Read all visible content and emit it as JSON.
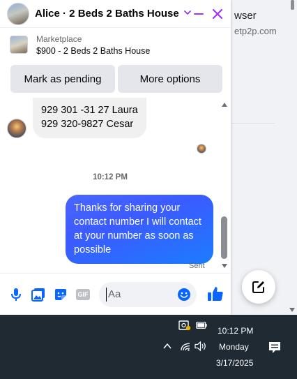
{
  "background": {
    "title": "wser",
    "subtitle": "etp2p.com"
  },
  "chat": {
    "header": {
      "title": "Alice · 2 Beds 2 Baths House",
      "accent_color": "#a033ff"
    },
    "marketplace": {
      "label": "Marketplace",
      "item": "$900 - 2 Beds 2 Baths House"
    },
    "actions": {
      "mark_pending": "Mark as pending",
      "more_options": "More options"
    },
    "messages": {
      "incoming_line1": "929 301 -31 27 Laura",
      "incoming_line2": "929 320-9827 Cesar",
      "time": "10:12 PM",
      "outgoing": "Thanks for sharing your contact number I will contact at your number as soon as possible",
      "status": "Sent",
      "outgoing_color": "#3b5bff"
    },
    "composer": {
      "placeholder": "Aa",
      "gif_label": "GIF",
      "icon_color": "#0866ff",
      "icons": [
        "microphone-icon",
        "photo-icon",
        "sticker-icon",
        "gif-icon",
        "emoji-icon",
        "thumbs-up-icon"
      ]
    }
  },
  "taskbar": {
    "time": "10:12 PM",
    "day": "Monday",
    "date": "3/17/2025"
  }
}
